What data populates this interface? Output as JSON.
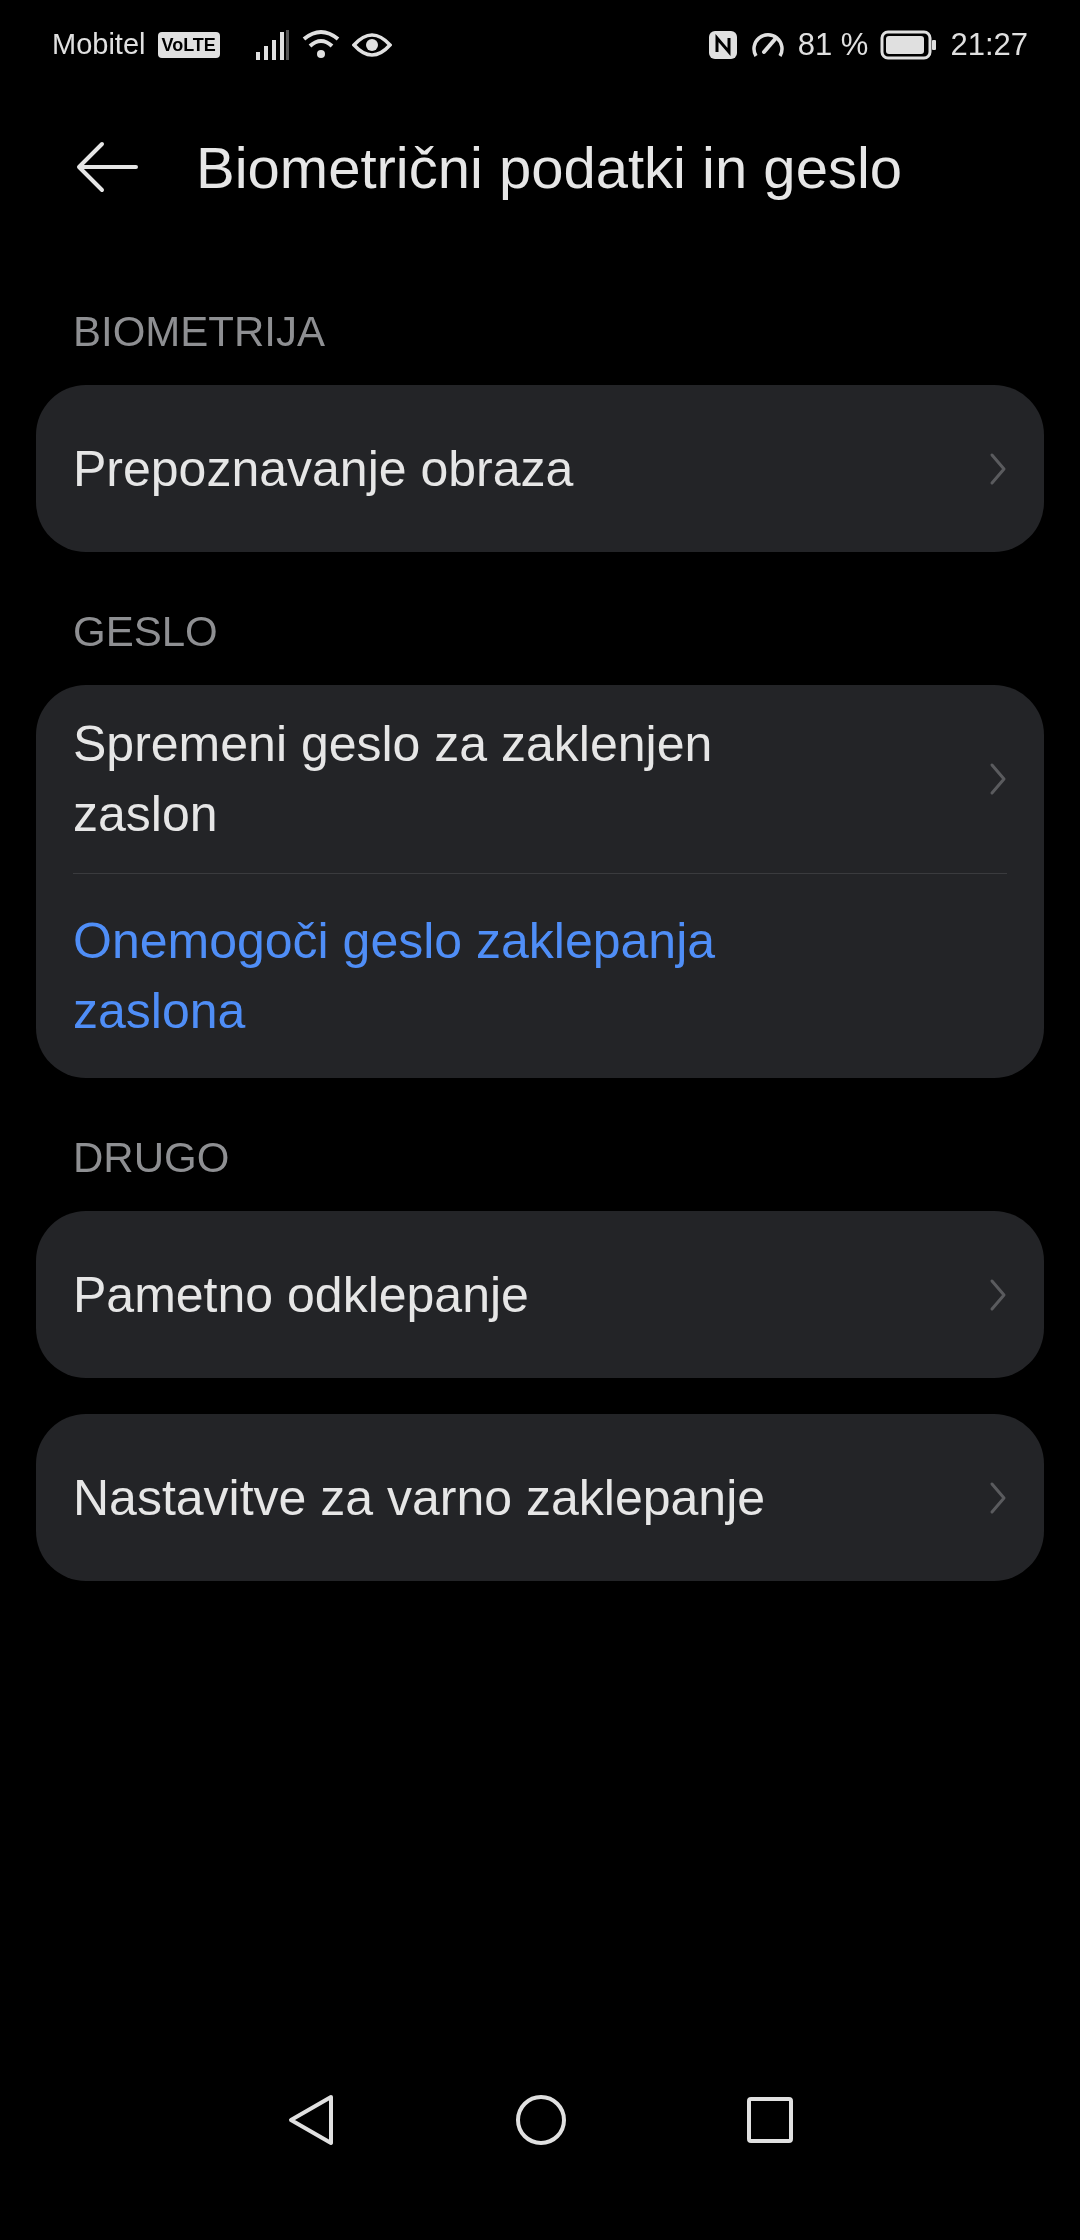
{
  "status_bar": {
    "carrier": "Mobitel",
    "volte": "VoLTE",
    "battery": "81 %",
    "time": "21:27"
  },
  "header": {
    "title": "Biometrični podatki in geslo"
  },
  "sections": [
    {
      "title": "BIOMETRIJA",
      "cards": [
        [
          {
            "kind": "link",
            "label": "Prepoznavanje obraza"
          }
        ]
      ]
    },
    {
      "title": "GESLO",
      "cards": [
        [
          {
            "kind": "link",
            "label": "Spremeni geslo za zaklenjen zaslon"
          },
          {
            "kind": "action",
            "label": "Onemogoči geslo zaklepanja zaslona"
          }
        ]
      ]
    },
    {
      "title": "DRUGO",
      "cards": [
        [
          {
            "kind": "link",
            "label": "Pametno odklepanje"
          }
        ],
        [
          {
            "kind": "link",
            "label": "Nastavitve za varno zaklepanje"
          }
        ]
      ]
    }
  ]
}
